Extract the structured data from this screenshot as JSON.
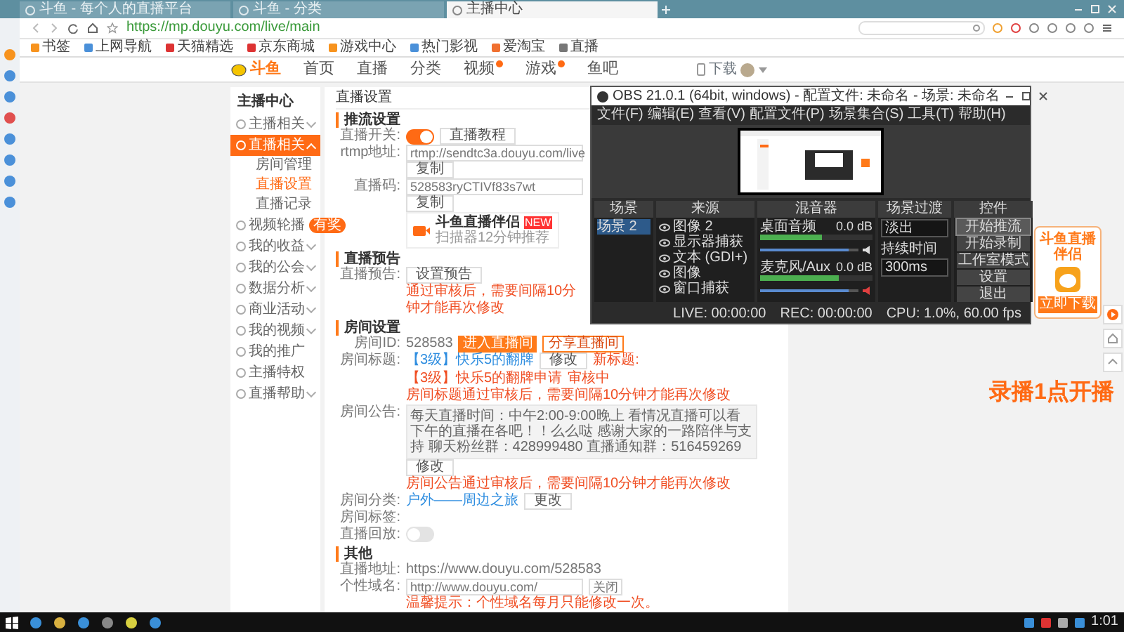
{
  "browser": {
    "tabs": [
      {
        "title": "斗鱼 - 每个人的直播平台",
        "selected": false
      },
      {
        "title": "斗鱼 - 分类",
        "selected": false
      },
      {
        "title": "主播中心",
        "selected": true
      }
    ],
    "address": "https://mp.douyu.com/live/main",
    "bookmarks": [
      "书签",
      "上网导航",
      "天猫精选",
      "京东商城",
      "游戏中心",
      "热门影视",
      "爱淘宝",
      "直播"
    ]
  },
  "site_header": {
    "logo": "斗鱼",
    "nav": [
      {
        "label": "首页",
        "badge": false
      },
      {
        "label": "直播",
        "badge": false
      },
      {
        "label": "分类",
        "badge": false
      },
      {
        "label": "视频",
        "badge": true
      },
      {
        "label": "游戏",
        "badge": true
      },
      {
        "label": "鱼吧",
        "badge": false
      }
    ],
    "download": "下载"
  },
  "sidebar": {
    "title": "主播中心",
    "items": [
      {
        "label": "主播相关",
        "selected": false,
        "expanded": false
      },
      {
        "label": "直播相关",
        "selected": true,
        "expanded": true,
        "children": [
          {
            "label": "房间管理",
            "selected": false
          },
          {
            "label": "直播设置",
            "selected": true
          },
          {
            "label": "直播记录",
            "selected": false
          }
        ]
      },
      {
        "label": "视频轮播",
        "selected": false,
        "tag": "有奖"
      },
      {
        "label": "我的收益",
        "selected": false,
        "expanded": false
      },
      {
        "label": "我的公会",
        "selected": false,
        "expanded": false
      },
      {
        "label": "数据分析",
        "selected": false,
        "expanded": false
      },
      {
        "label": "商业活动",
        "selected": false,
        "expanded": false
      },
      {
        "label": "我的视频",
        "selected": false,
        "expanded": false
      },
      {
        "label": "我的推广",
        "selected": false
      },
      {
        "label": "主播特权",
        "selected": false
      },
      {
        "label": "直播帮助",
        "selected": false,
        "expanded": false
      }
    ]
  },
  "page_title": "直播设置",
  "sections": [
    {
      "heading": "推流设置",
      "rows": [
        {
          "label": "直播开关:",
          "items": [
            {
              "kind": "toggle",
              "on": true
            },
            {
              "kind": "button",
              "text": "直播教程"
            }
          ]
        },
        {
          "label": "rtmp地址:",
          "items": [
            {
              "kind": "field",
              "text": "rtmp://sendtc3a.douyu.com/live"
            }
          ]
        },
        {
          "items": [
            {
              "kind": "button",
              "text": "复制"
            }
          ]
        },
        {
          "label": "直播码:",
          "items": [
            {
              "kind": "field",
              "text": "528583ryCTIVf83s7wt"
            }
          ]
        },
        {
          "items": [
            {
              "kind": "button",
              "text": "复制"
            }
          ]
        },
        {
          "items": [
            {
              "kind": "card",
              "text": "斗鱼直播伴侣",
              "sub": "扫描器12分钟推荐",
              "badge": "NEW"
            }
          ]
        }
      ]
    },
    {
      "heading": "直播预告",
      "rows": [
        {
          "label": "直播预告:",
          "items": [
            {
              "kind": "button",
              "text": "设置预告"
            }
          ]
        },
        {
          "items": [
            {
              "kind": "note",
              "text": "通过审核后，需要间隔10分钟才能再次修改"
            }
          ]
        }
      ]
    },
    {
      "heading": "房间设置",
      "rows": [
        {
          "label": "房间ID:",
          "items": [
            {
              "kind": "text",
              "text": "528583"
            },
            {
              "kind": "primary",
              "text": "进入直播间"
            },
            {
              "kind": "outline",
              "text": "分享直播间"
            }
          ]
        },
        {
          "label": "房间标题:",
          "items": [
            {
              "kind": "link",
              "text": "【3级】快乐5的翻牌"
            },
            {
              "kind": "button",
              "text": "修改"
            },
            {
              "kind": "note",
              "text": "新标题:"
            },
            {
              "kind": "note",
              "text": "【3级】快乐5的翻牌申请"
            },
            {
              "kind": "note",
              "text": "审核中"
            }
          ]
        },
        {
          "items": [
            {
              "kind": "note",
              "text": "房间标题通过审核后，需要间隔10分钟才能再次修改"
            }
          ]
        },
        {
          "label": "房间公告:",
          "items": [
            {
              "kind": "textarea",
              "text": "每天直播时间：中午2:00-9:00晚上 看情况直播可以看下午的直播在各吧！！么么哒 感谢大家的一路陪伴与支持 聊天粉丝群：428999480 直播通知群：516459269"
            }
          ]
        },
        {
          "items": [
            {
              "kind": "button",
              "text": "修改"
            }
          ]
        },
        {
          "items": [
            {
              "kind": "note",
              "text": "房间公告通过审核后，需要间隔10分钟才能再次修改"
            }
          ]
        },
        {
          "label": "房间分类:",
          "items": [
            {
              "kind": "link",
              "text": "户外——周边之旅"
            },
            {
              "kind": "button",
              "text": "更改"
            }
          ]
        },
        {
          "label": "房间标签:",
          "items": []
        },
        {
          "label": "直播回放:",
          "items": [
            {
              "kind": "toggle",
              "on": false
            }
          ]
        }
      ]
    },
    {
      "heading": "其他",
      "rows": [
        {
          "label": "直播地址:",
          "items": [
            {
              "kind": "text",
              "text": "https://www.douyu.com/528583"
            }
          ]
        },
        {
          "label": "个性域名:",
          "items": [
            {
              "kind": "field",
              "text": "http://www.douyu.com/"
            },
            {
              "kind": "select",
              "text": "关闭"
            }
          ]
        },
        {
          "items": [
            {
              "kind": "note",
              "text": "温馨提示：个性域名每月只能修改一次。"
            }
          ]
        }
      ]
    }
  ],
  "promo": {
    "title": "斗鱼直播伴侣",
    "button": "立即下载"
  },
  "overlay_text": "录播1点开播",
  "obs": {
    "title": "OBS 21.0.1 (64bit, windows) - 配置文件: 未命名 - 场景: 未命名",
    "menus": [
      "文件(F)",
      "编辑(E)",
      "查看(V)",
      "配置文件(P)",
      "场景集合(S)",
      "工具(T)",
      "帮助(H)"
    ],
    "scenes": {
      "title": "场景",
      "items": [
        {
          "label": "场景 2",
          "selected": true
        }
      ]
    },
    "sources": {
      "title": "来源",
      "items": [
        "图像 2",
        "显示器捕获",
        "文本 (GDI+)",
        "图像",
        "窗口捕获"
      ]
    },
    "mixer": {
      "title": "混音器",
      "channels": [
        {
          "name": "桌面音频",
          "reading": "0.0 dB",
          "level": 0.55,
          "volume": {
            "level": 0.9
          },
          "muted": false
        },
        {
          "name": "麦克风/Aux",
          "reading": "0.0 dB",
          "level": 0.7,
          "volume": {
            "level": 0.9
          },
          "muted": true
        }
      ]
    },
    "transitions": {
      "title": "场景过渡",
      "value": "淡出",
      "duration_label": "持续时间",
      "duration": "300ms"
    },
    "controls": {
      "title": "控件",
      "buttons": [
        {
          "label": "开始推流",
          "selected": true
        },
        {
          "label": "开始录制",
          "selected": false
        },
        {
          "label": "工作室模式",
          "selected": false
        },
        {
          "label": "设置",
          "selected": false
        },
        {
          "label": "退出",
          "selected": false
        }
      ]
    },
    "status": [
      "LIVE: 00:00:00",
      "REC: 00:00:00",
      "CPU: 1.0%, 60.00 fps"
    ]
  },
  "taskbar": {
    "time": "1:01"
  }
}
